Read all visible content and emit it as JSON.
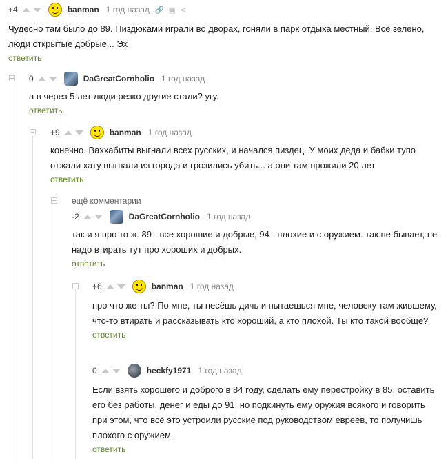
{
  "comments": [
    {
      "rating": "+4",
      "author": "banman",
      "time": "1 год назад",
      "text": "Чудесно там было до 89. Пиздюками играли во дворах, гоняли в парк отдыха местный. Всё зелено, люди открытые добрые... Эх",
      "reply": "ответить"
    },
    {
      "rating": "0",
      "author": "DaGreatCornholio",
      "time": "1 год назад",
      "text": "а в через 5 лет люди резко другие стали? угу.",
      "reply": "ответить"
    },
    {
      "rating": "+9",
      "author": "banman",
      "time": "1 год назад",
      "text": "конечно. Ваххабиты выгнали всех русских, и начался пиздец. У моих деда и бабки тупо отжали хату выгнали из города и грозились убить... а они там прожили 20 лет",
      "reply": "ответить"
    },
    {
      "rating": "-2",
      "author": "DaGreatCornholio",
      "time": "1 год назад",
      "text": "так и я про то ж. 89 - все хорошие и добрые, 94 - плохие и с оружием. так не бывает, не надо втирать тут про хороших и добрых.",
      "reply": "ответить"
    },
    {
      "rating": "+6",
      "author": "banman",
      "time": "1 год назад",
      "text": "про что же ты? По мне, ты несёшь дичь и пытаешься мне, человеку там жившему, что-то втирать и рассказывать кто хороший, а кто плохой. Ты кто такой вообще?",
      "reply": "ответить"
    },
    {
      "rating": "0",
      "author": "heckfy1971",
      "time": "1 год назад",
      "text": "Если взять хорошего и доброго в 84 году, сделать ему перестройку в 85, оставить его без работы, денег и еды до 91, но подкинуть ему оружия всякого и говорить при этом, что всё это устроили русские под руководством евреев, то получишь плохого с оружием.",
      "reply": "ответить"
    }
  ],
  "more_comments_label": "ещё комментарии"
}
